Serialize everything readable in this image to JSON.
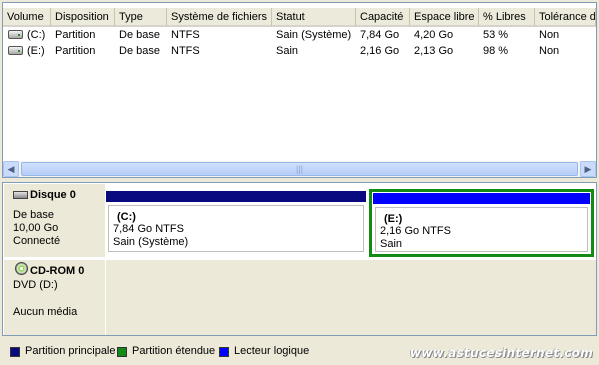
{
  "columns": [
    "Volume",
    "Disposition",
    "Type",
    "Système de fichiers",
    "Statut",
    "Capacité",
    "Espace libre",
    "% Libres",
    "Tolérance de"
  ],
  "volumes": [
    {
      "volume": "(C:)",
      "disposition": "Partition",
      "type": "De base",
      "fs": "NTFS",
      "status": "Sain (Système)",
      "capacity": "7,84 Go",
      "free": "4,20 Go",
      "pct": "53 %",
      "tolerance": "Non"
    },
    {
      "volume": "(E:)",
      "disposition": "Partition",
      "type": "De base",
      "fs": "NTFS",
      "status": "Sain",
      "capacity": "2,16 Go",
      "free": "2,13 Go",
      "pct": "98 %",
      "tolerance": "Non"
    }
  ],
  "scrollbar": {
    "left_arrow": "◀",
    "right_arrow": "▶",
    "grip": "|||"
  },
  "disks": [
    {
      "title": "Disque 0",
      "type": "De base",
      "size": "10,00 Go",
      "state": "Connecté",
      "icon": "hard-disk-icon"
    },
    {
      "title": "CD-ROM 0",
      "type": "DVD (D:)",
      "size": "",
      "state": "Aucun média",
      "icon": "cd-rom-icon"
    }
  ],
  "partitions": [
    {
      "name": "(C:)",
      "size_fs": "7,84 Go NTFS",
      "status": "Sain (Système)",
      "bar_color": "#0a0a80"
    },
    {
      "name": "(E:)",
      "size_fs": "2,16 Go NTFS",
      "status": "Sain",
      "bar_color": "#0000ff",
      "frame_color": "#138a13"
    }
  ],
  "legend": [
    {
      "label": "Partition principale",
      "color": "#0a0a80"
    },
    {
      "label": "Partition étendue",
      "color": "#138a13"
    },
    {
      "label": "Lecteur logique",
      "color": "#0000ff"
    }
  ],
  "watermark": "www.astucesinternet.com"
}
